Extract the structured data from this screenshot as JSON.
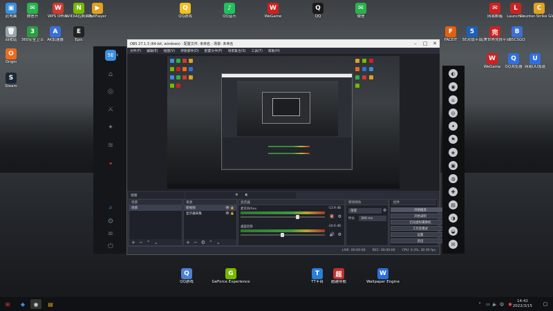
{
  "desktop": {
    "top_icons": [
      {
        "label": "此电脑",
        "color": "#3b8edb",
        "glyph": "▣"
      },
      {
        "label": "微信开",
        "color": "#2bb24c",
        "glyph": "✉"
      },
      {
        "label": "WPS Office",
        "color": "#d03a2f",
        "glyph": "W"
      },
      {
        "label": "NVIDIA控制面板",
        "color": "#76b900",
        "glyph": "N"
      },
      {
        "label": "PotPlayer",
        "color": "#e0a020",
        "glyph": "▶"
      },
      {
        "label": "QQ游戏",
        "color": "#f0c020",
        "glyph": "Q"
      },
      {
        "label": "QQ音乐",
        "color": "#1fc060",
        "glyph": "♪"
      },
      {
        "label": "WeGame",
        "color": "#d02020",
        "glyph": "W"
      },
      {
        "label": "QQ",
        "color": "#1a1a1a",
        "glyph": "Q"
      },
      {
        "label": "微信",
        "color": "#2bb24c",
        "glyph": "✉"
      },
      {
        "label": "网易邮箱",
        "color": "#cc2222",
        "glyph": "✉"
      },
      {
        "label": "Launcher",
        "color": "#cc2222",
        "glyph": "L"
      },
      {
        "label": "Counter-Strike Global Off",
        "color": "#e0a020",
        "glyph": "C"
      }
    ],
    "row2_icons": [
      {
        "label": "回收站",
        "color": "#9aa4ad",
        "glyph": "🗑"
      },
      {
        "label": "360安全卫士",
        "color": "#2b9d40",
        "glyph": "3"
      },
      {
        "label": "AK加速器",
        "color": "#3a6fd8",
        "glyph": "A"
      },
      {
        "label": "Epic",
        "color": "#222",
        "glyph": "E"
      },
      {
        "label": "FACEIT",
        "color": "#e06010",
        "glyph": "F"
      },
      {
        "label": "5E对战平台",
        "color": "#1c5fb8",
        "glyph": "5"
      },
      {
        "label": "完美世界竞技平台",
        "color": "#cc2222",
        "glyph": "完"
      },
      {
        "label": "B5CSGO",
        "color": "#3a6fd8",
        "glyph": "B"
      }
    ],
    "row3_icons": [
      {
        "label": "Origin",
        "color": "#f06a1a",
        "glyph": "O"
      },
      {
        "label": "Steam",
        "color": "#1b2838",
        "glyph": "S"
      },
      {
        "label": "WeGame",
        "color": "#d02020",
        "glyph": "W"
      },
      {
        "label": "QQ浏览器",
        "color": "#2f6fe0",
        "glyph": "Q"
      },
      {
        "label": "网易UU加速",
        "color": "#2f6fe0",
        "glyph": "U"
      }
    ],
    "bottom_icons": [
      {
        "label": "QQ游戏",
        "color": "#4a80d8",
        "glyph": "Q"
      },
      {
        "label": "GeForce Experience",
        "color": "#76b900",
        "glyph": "G"
      },
      {
        "label": "TT平台",
        "color": "#2a7fd8",
        "glyph": "T"
      },
      {
        "label": "超越导航",
        "color": "#c03030",
        "glyph": "超"
      },
      {
        "label": "Wallpaper Engine",
        "color": "#2a6fd8",
        "glyph": "W"
      }
    ]
  },
  "obs": {
    "title": "OBS 27.1.3 (64-bit, windows) - 配置文件: 未命名 - 场景: 未命名",
    "menu": [
      "文件(F)",
      "编辑(E)",
      "视图(V)",
      "停靠部件(D)",
      "配置文件(P)",
      "场景集合(S)",
      "工具(T)",
      "帮助(H)"
    ],
    "docks": {
      "scenes_header": "场景",
      "scenes": [
        "场景"
      ],
      "sources_header": "来源",
      "sources": [
        "新视频",
        "显示器采集"
      ],
      "mixer_header": "混音器",
      "mixer": [
        {
          "name": "麦克风/Aux",
          "db": "-13.9 dB"
        },
        {
          "name": "桌面音频",
          "db": "-20.6 dB"
        }
      ],
      "transitions_header": "转场特效",
      "transition_type": "渐变",
      "duration_label": "时长",
      "duration_value": "300 ms",
      "controls_header": "控件",
      "controls": [
        "开始推流",
        "开始录制",
        "启动虚拟摄像机",
        "工作室模式",
        "设置",
        "退出"
      ]
    },
    "status": {
      "live": "LIVE: 00:00:00",
      "rec": "REC: 00:00:00",
      "cpu": "CPU: 0.3%, 30.00 fps"
    }
  },
  "taskbar": {
    "time": "14:42",
    "date": "2022/3/15"
  }
}
